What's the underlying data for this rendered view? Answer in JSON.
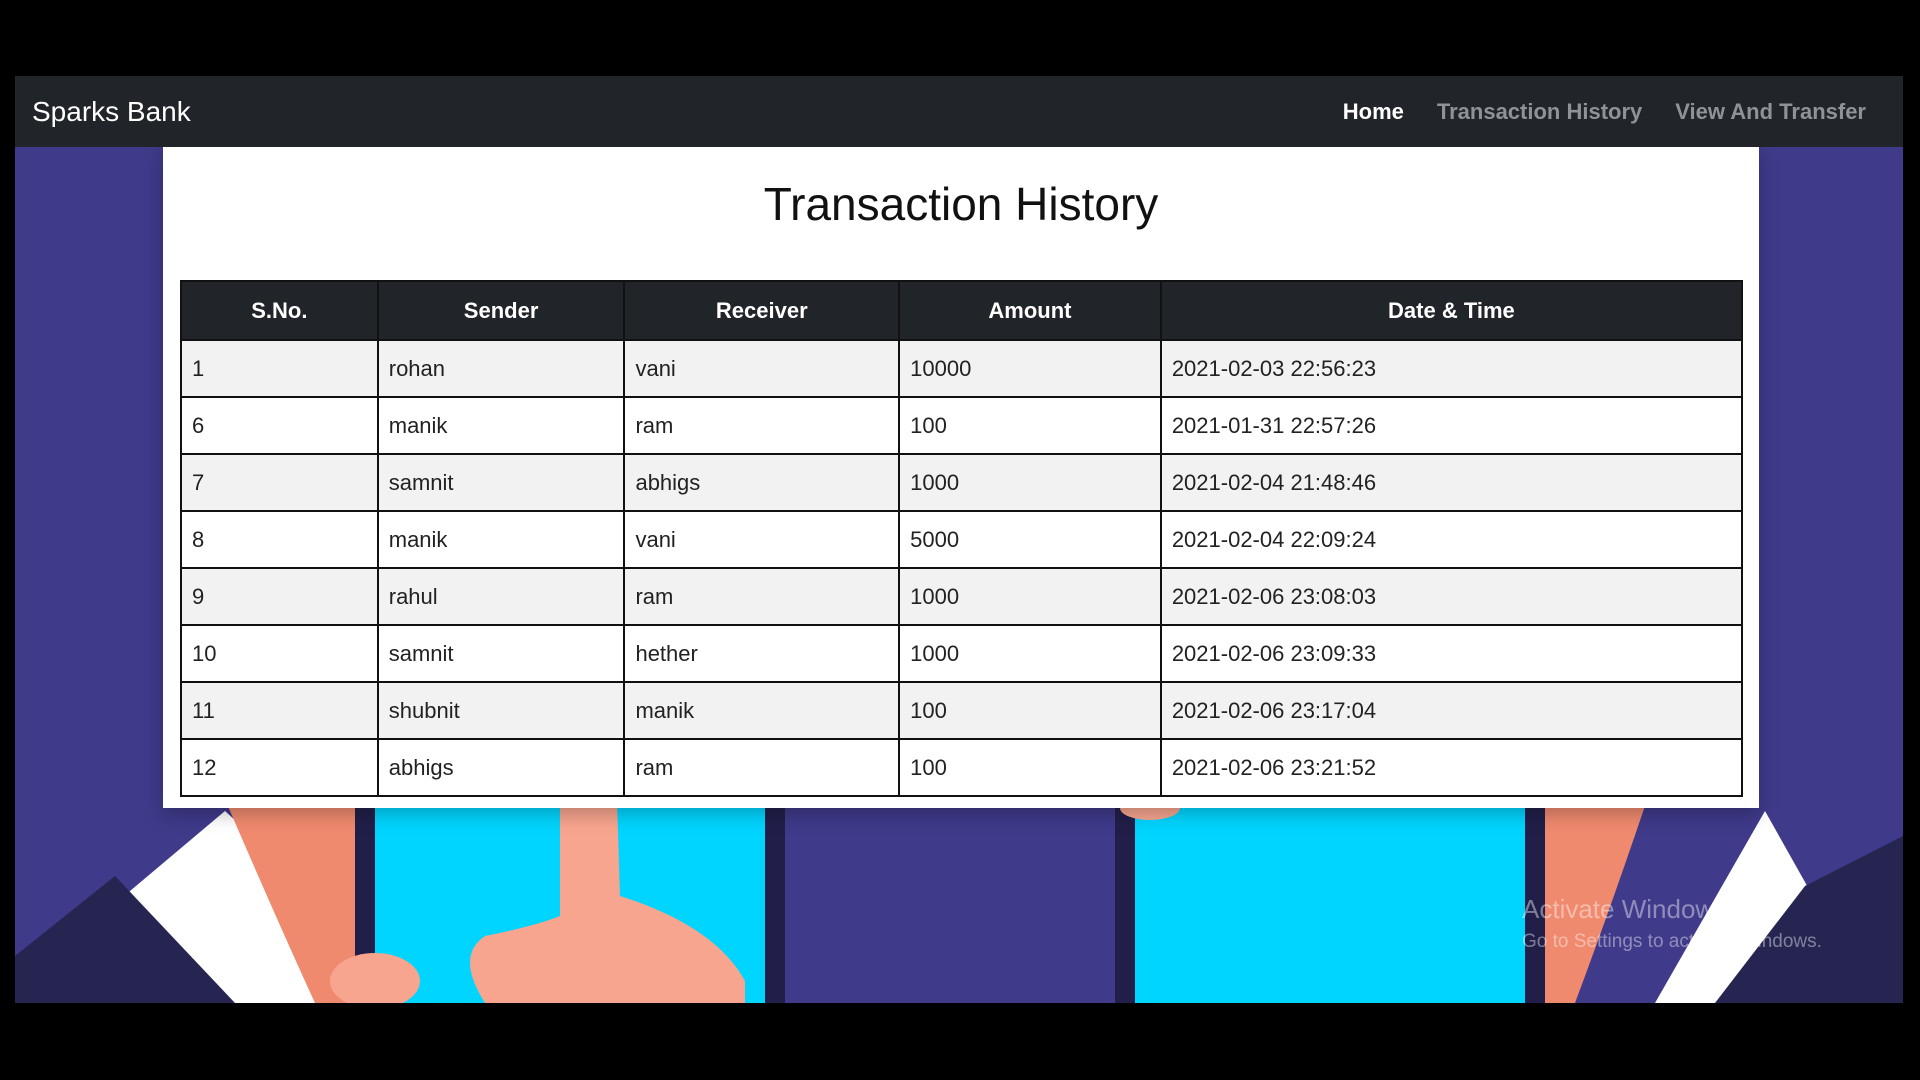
{
  "navbar": {
    "brand": "Sparks Bank",
    "links": [
      {
        "label": "Home",
        "active": true
      },
      {
        "label": "Transaction History",
        "active": false
      },
      {
        "label": "View And Transfer",
        "active": false
      }
    ]
  },
  "page": {
    "title": "Transaction History"
  },
  "table": {
    "headers": [
      "S.No.",
      "Sender",
      "Receiver",
      "Amount",
      "Date & Time"
    ],
    "rows": [
      [
        "1",
        "rohan",
        "vani",
        "10000",
        "2021-02-03 22:56:23"
      ],
      [
        "6",
        "manik",
        "ram",
        "100",
        "2021-01-31 22:57:26"
      ],
      [
        "7",
        "samnit",
        "abhigs",
        "1000",
        "2021-02-04 21:48:46"
      ],
      [
        "8",
        "manik",
        "vani",
        "5000",
        "2021-02-04 22:09:24"
      ],
      [
        "9",
        "rahul",
        "ram",
        "1000",
        "2021-02-06 23:08:03"
      ],
      [
        "10",
        "samnit",
        "hether",
        "1000",
        "2021-02-06 23:09:33"
      ],
      [
        "11",
        "shubnit",
        "manik",
        "100",
        "2021-02-06 23:17:04"
      ],
      [
        "12",
        "abhigs",
        "ram",
        "100",
        "2021-02-06 23:21:52"
      ]
    ]
  },
  "watermark": {
    "title": "Activate Windows",
    "subtitle": "Go to Settings to activate Windows."
  },
  "colors": {
    "navbar_bg": "#212529",
    "page_bg": "#3f3a8a",
    "phone_screen": "#00d5ff",
    "skin": "#f7a58e"
  }
}
